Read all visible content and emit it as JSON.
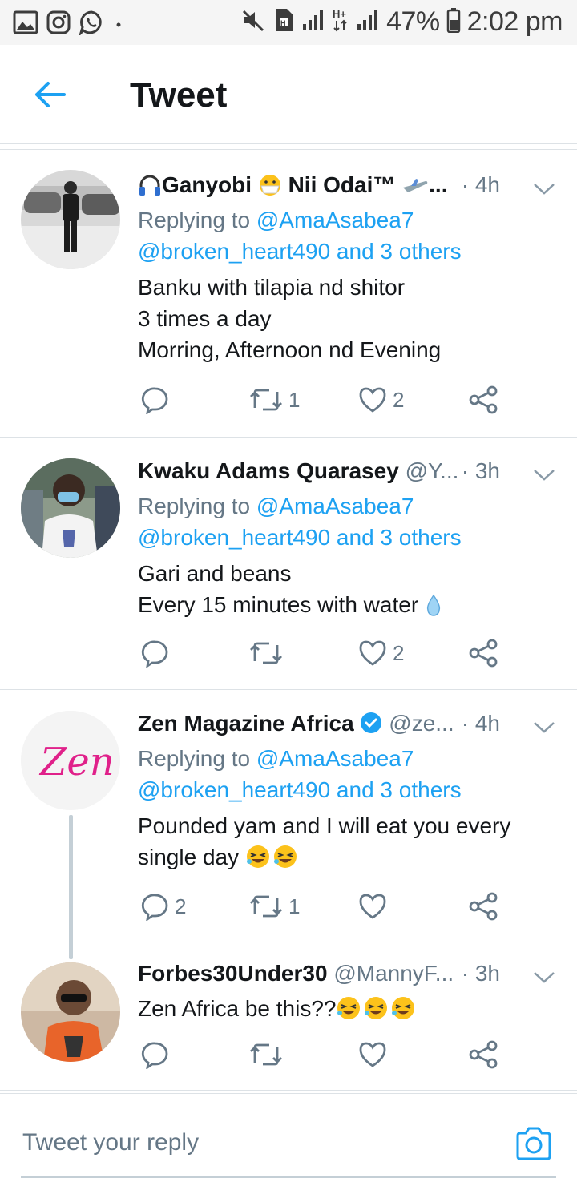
{
  "status_bar": {
    "battery": "47%",
    "time": "2:02 pm"
  },
  "header": {
    "title": "Tweet"
  },
  "tweets": [
    {
      "name": "Ganyobi",
      "name2": "Nii Odai™",
      "ellipsis": "...",
      "time": "· 4h",
      "replying_prefix": "Replying to ",
      "mention1": "@AmaAsabea7",
      "mention2": "@broken_heart490 and 3 others",
      "lines": [
        "Banku with tilapia nd shitor",
        "3 times a day",
        "Morring, Afternoon nd Evening"
      ],
      "replies": "",
      "retweets": "1",
      "likes": "2"
    },
    {
      "name": "Kwaku Adams Quarasey",
      "handle": "@Y...",
      "time": "· 3h",
      "replying_prefix": "Replying to ",
      "mention1": "@AmaAsabea7",
      "mention2": "@broken_heart490 and 3 others",
      "lines": [
        "Gari and beans",
        "Every 15 minutes with water"
      ],
      "replies": "",
      "retweets": "",
      "likes": "2"
    },
    {
      "name": "Zen Magazine Africa",
      "handle": "@ze...",
      "time": "· 4h",
      "replying_prefix": "Replying to ",
      "mention1": "@AmaAsabea7",
      "mention2": "@broken_heart490 and 3 others",
      "lines": [
        "Pounded yam and I will eat you every",
        "single day"
      ],
      "avatar_logo": "Zen",
      "replies": "2",
      "retweets": "1",
      "likes": ""
    },
    {
      "name": "Forbes30Under30",
      "handle": "@MannyF...",
      "time": "· 3h",
      "lines": [
        "Zen Africa be this??"
      ],
      "replies": "",
      "retweets": "",
      "likes": ""
    }
  ],
  "compose": {
    "placeholder": "Tweet your reply"
  },
  "colors": {
    "accent": "#1da1f2",
    "muted": "#657786",
    "text": "#14171a",
    "divider": "#dde2e6"
  },
  "icons": [
    "gallery-icon",
    "instagram-icon",
    "whatsapp-icon",
    "mute-icon",
    "sim-icon",
    "signal-icon",
    "battery-icon",
    "back-arrow-icon",
    "chevron-down-icon",
    "reply-icon",
    "retweet-icon",
    "like-icon",
    "share-icon",
    "camera-icon",
    "verified-icon"
  ]
}
